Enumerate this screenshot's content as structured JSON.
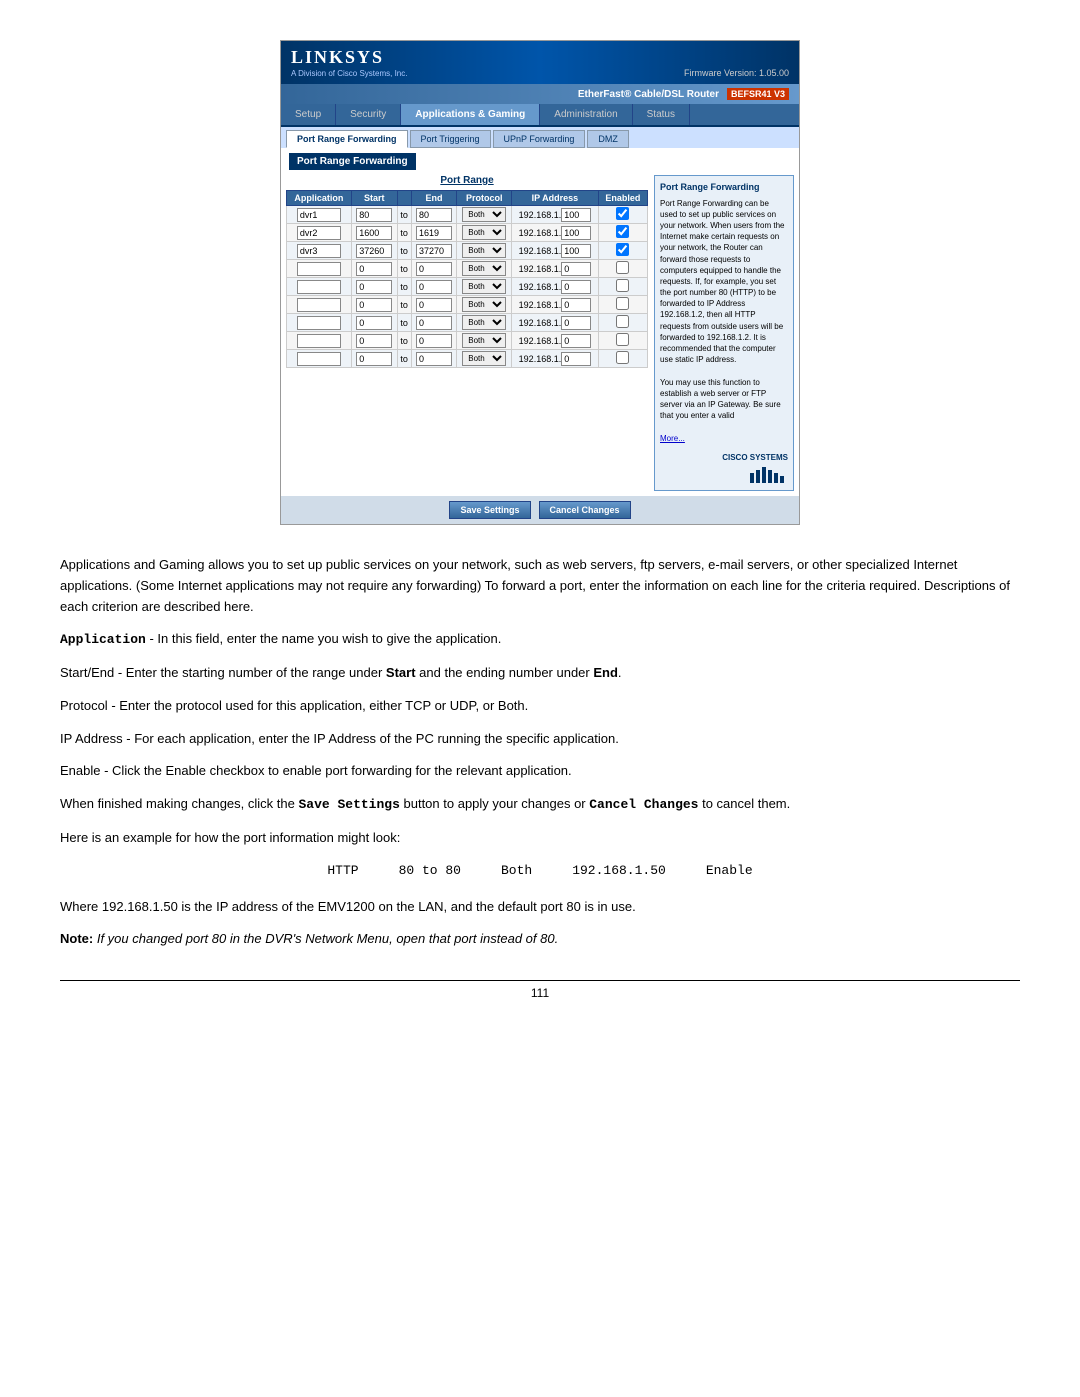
{
  "router": {
    "logo": "LINKSYS",
    "logo_sub": "A Division of Cisco Systems, Inc.",
    "firmware": "Firmware Version: 1.05.00",
    "product_name": "EtherFast® Cable/DSL Router",
    "model": "BEFSR41 V3",
    "nav_tabs": [
      {
        "label": "Setup",
        "active": false
      },
      {
        "label": "Security",
        "active": false
      },
      {
        "label": "Applications & Gaming",
        "active": true
      },
      {
        "label": "Administration",
        "active": false
      },
      {
        "label": "Status",
        "active": false
      }
    ],
    "sub_tabs": [
      {
        "label": "Port Range Forwarding",
        "active": true
      },
      {
        "label": "Port Triggering",
        "active": false
      },
      {
        "label": "UPnP Forwarding",
        "active": false
      },
      {
        "label": "DMZ",
        "active": false
      }
    ],
    "page_section": "Port Range Forwarding",
    "table": {
      "title": "Port Range",
      "headers": [
        "Application",
        "Start",
        "",
        "End",
        "Protocol",
        "IP Address",
        "Enabled"
      ],
      "rows": [
        {
          "app": "dvr1",
          "start": "80",
          "end": "80",
          "protocol": "Both",
          "ip_prefix": "192.168.1.",
          "ip_last": "100",
          "enabled": true
        },
        {
          "app": "dvr2",
          "start": "1600",
          "end": "1619",
          "protocol": "Both",
          "ip_prefix": "192.168.1.",
          "ip_last": "100",
          "enabled": true
        },
        {
          "app": "dvr3",
          "start": "37260",
          "end": "37270",
          "protocol": "Both",
          "ip_prefix": "192.168.1.",
          "ip_last": "100",
          "enabled": true
        },
        {
          "app": "",
          "start": "0",
          "end": "0",
          "protocol": "Both",
          "ip_prefix": "192.168.1.",
          "ip_last": "0",
          "enabled": false
        },
        {
          "app": "",
          "start": "0",
          "end": "0",
          "protocol": "Both",
          "ip_prefix": "192.168.1.",
          "ip_last": "0",
          "enabled": false
        },
        {
          "app": "",
          "start": "0",
          "end": "0",
          "protocol": "Both",
          "ip_prefix": "192.168.1.",
          "ip_last": "0",
          "enabled": false
        },
        {
          "app": "",
          "start": "0",
          "end": "0",
          "protocol": "Both",
          "ip_prefix": "192.168.1.",
          "ip_last": "0",
          "enabled": false
        },
        {
          "app": "",
          "start": "0",
          "end": "0",
          "protocol": "Both",
          "ip_prefix": "192.168.1.",
          "ip_last": "0",
          "enabled": false
        },
        {
          "app": "",
          "start": "0",
          "end": "0",
          "protocol": "Both",
          "ip_prefix": "192.168.1.",
          "ip_last": "0",
          "enabled": false
        }
      ]
    },
    "buttons": {
      "save": "Save Settings",
      "cancel": "Cancel Changes"
    },
    "sidebar": {
      "title": "Port Range Forwarding",
      "text": "Port Range Forwarding can be used to set up public services on your network. When users from the Internet make certain requests on your network, the Router can forward those requests to computers equipped to handle the requests. If, for example, you set the port number 80 (HTTP) to be forwarded to IP Address 192.168.1.2, then all HTTP requests from outside users will be forwarded to 192.168.1.2. It is recommended that the computer use static IP address.",
      "text2": "You may use this function to establish a web server or FTP server via an IP Gateway. Be sure that you enter a valid",
      "more": "More...",
      "cisco": "CISCO SYSTEMS"
    }
  },
  "description": {
    "intro": "Applications and Gaming allows you to set up public services on your network, such as web servers, ftp servers, e-mail servers, or other specialized Internet applications. (Some Internet applications may not require any forwarding) To forward a port, enter the information on each line for the criteria required. Descriptions of each criterion are described here.",
    "application_label": "Application",
    "application_text": " - In this field, enter the name you wish to give the application.",
    "startend_label": "Start/End",
    "startend_text1": " - Enter the starting number of the range under ",
    "startend_start": "Start",
    "startend_text2": " and the ending number under ",
    "startend_end": "End",
    "startend_text3": ".",
    "protocol_label": "Protocol",
    "protocol_text": " - Enter the protocol used for this application, either TCP or UDP, or Both.",
    "ipaddress_label": "IP Address",
    "ipaddress_text": " - For each application, enter the IP Address of the PC running the specific application.",
    "enable_label": "Enable",
    "enable_text": " - Click the Enable checkbox to enable port forwarding for the relevant application.",
    "finish_text1": "When finished making changes, click the ",
    "finish_savesettings": "Save Settings",
    "finish_text2": " button to apply your changes or ",
    "finish_cancel": "Cancel Changes",
    "finish_text3": " to cancel them.",
    "example_intro": "Here is an example for how the port information might look:",
    "example_http": "HTTP",
    "example_range": "80 to 80",
    "example_both": "Both",
    "example_ip": "192.168.1.50",
    "example_enable": "Enable",
    "where_text": "Where 192.168.1.50 is the IP address of the EMV1200 on the LAN, and the default port 80 is in use.",
    "note_label": "Note:",
    "note_italic": "If you changed port 80 in the DVR's Network Menu, open that port instead of 80."
  },
  "page_number": "111"
}
